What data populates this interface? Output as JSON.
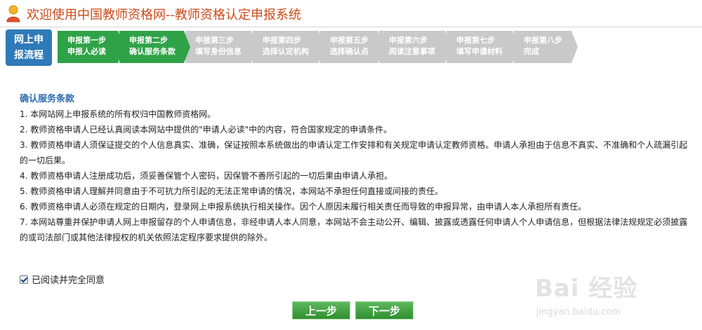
{
  "header": {
    "title": "欢迎使用中国教师资格网--教师资格认定申报系统"
  },
  "steps": {
    "start_label": [
      "网上申",
      "报流程"
    ],
    "items": [
      {
        "line1": "申报第一步",
        "line2": "申报人必读",
        "status": "done"
      },
      {
        "line1": "申报第二步",
        "line2": "确认服务条款",
        "status": "done"
      },
      {
        "line1": "申报第三步",
        "line2": "填写身份信息",
        "status": "todo"
      },
      {
        "line1": "申报第四步",
        "line2": "选择认定机构",
        "status": "todo"
      },
      {
        "line1": "申报第五步",
        "line2": "选择确认点",
        "status": "todo"
      },
      {
        "line1": "申报第六步",
        "line2": "阅读注意事项",
        "status": "todo"
      },
      {
        "line1": "申报第七步",
        "line2": "填写申请材料",
        "status": "todo"
      },
      {
        "line1": "申报第八步",
        "line2": "完成",
        "status": "todo"
      }
    ]
  },
  "terms": {
    "title": "确认服务条款",
    "items": [
      "1. 本网站网上申报系统的所有权归中国教师资格网。",
      "2. 教师资格申请人已经认真阅读本网站中提供的\"申请人必读\"中的内容，符合国家规定的申请条件。",
      "3. 教师资格申请人须保证提交的个人信息真实、准确，保证按照本系统做出的申请认定工作安排和有关规定申请认定教师资格。申请人承担由于信息不真实、不准确和个人疏漏引起的一切后果。",
      "4. 教师资格申请人注册成功后，须妥善保管个人密码，因保管不善所引起的一切后果由申请人承担。",
      "5. 教师资格申请人理解并同意由于不可抗力所引起的无法正常申请的情况，本网站不承担任何直接或间接的责任。",
      "6. 教师资格申请人必须在规定的日期内，登录网上申报系统执行相关操作。因个人原因未履行相关责任而导致的申报异常，由申请人本人承担所有责任。",
      "7. 本网站尊重并保护申请人网上申报留存的个人申请信息，非经申请人本人同意，本网站不会主动公开、编辑、披露或透露任何申请人个人申请信息，但根据法律法规规定必须披露的或司法部门或其他法律授权的机关依照法定程序要求提供的除外。"
    ]
  },
  "agree": {
    "label": "已阅读并完全同意",
    "checked": true
  },
  "buttons": {
    "prev": "上一步",
    "next": "下一步"
  },
  "watermark": {
    "brand": "Bai 经验",
    "url": "jingyan.baidu.com"
  },
  "colors": {
    "accent_orange": "#cc4a1a",
    "step_done": "#2fa247",
    "step_todo": "#c9c9c9",
    "start_blue": "#2f7ab8",
    "title_blue": "#2c6bb0"
  }
}
